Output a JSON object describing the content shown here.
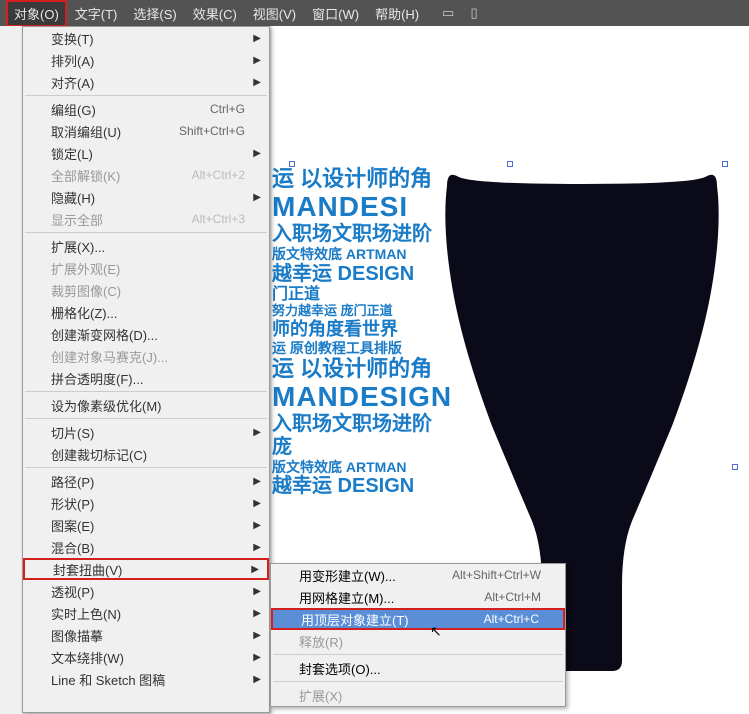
{
  "menubar": {
    "items": [
      "对象(O)",
      "文字(T)",
      "选择(S)",
      "效果(C)",
      "视图(V)",
      "窗口(W)",
      "帮助(H)"
    ]
  },
  "dropdown": {
    "items": [
      {
        "label": "变换(T)",
        "arrow": true
      },
      {
        "label": "排列(A)",
        "arrow": true
      },
      {
        "label": "对齐(A)",
        "arrow": true
      },
      {
        "sep": true
      },
      {
        "label": "编组(G)",
        "shortcut": "Ctrl+G"
      },
      {
        "label": "取消编组(U)",
        "shortcut": "Shift+Ctrl+G"
      },
      {
        "label": "锁定(L)",
        "arrow": true
      },
      {
        "label": "全部解锁(K)",
        "shortcut": "Alt+Ctrl+2",
        "disabled": true
      },
      {
        "label": "隐藏(H)",
        "arrow": true
      },
      {
        "label": "显示全部",
        "shortcut": "Alt+Ctrl+3",
        "disabled": true
      },
      {
        "sep": true
      },
      {
        "label": "扩展(X)..."
      },
      {
        "label": "扩展外观(E)",
        "disabled": true
      },
      {
        "label": "裁剪图像(C)",
        "disabled": true
      },
      {
        "label": "栅格化(Z)..."
      },
      {
        "label": "创建渐变网格(D)..."
      },
      {
        "label": "创建对象马赛克(J)...",
        "disabled": true
      },
      {
        "label": "拼合透明度(F)..."
      },
      {
        "sep": true
      },
      {
        "label": "设为像素级优化(M)"
      },
      {
        "sep": true
      },
      {
        "label": "切片(S)",
        "arrow": true
      },
      {
        "label": "创建裁切标记(C)"
      },
      {
        "sep": true
      },
      {
        "label": "路径(P)",
        "arrow": true
      },
      {
        "label": "形状(P)",
        "arrow": true
      },
      {
        "label": "图案(E)",
        "arrow": true
      },
      {
        "label": "混合(B)",
        "arrow": true
      },
      {
        "label": "封套扭曲(V)",
        "arrow": true,
        "highlighted": true
      },
      {
        "label": "透视(P)",
        "arrow": true
      },
      {
        "label": "实时上色(N)",
        "arrow": true
      },
      {
        "label": "图像描摹",
        "arrow": true
      },
      {
        "label": "文本绕排(W)",
        "arrow": true
      },
      {
        "label": "Line 和 Sketch 图稿",
        "arrow": true
      },
      {
        "sep_partial": true
      }
    ]
  },
  "submenu": {
    "items": [
      {
        "label": "用变形建立(W)...",
        "shortcut": "Alt+Shift+Ctrl+W"
      },
      {
        "label": "用网格建立(M)...",
        "shortcut": "Alt+Ctrl+M"
      },
      {
        "label": "用顶层对象建立(T)",
        "shortcut": "Alt+Ctrl+C",
        "highlighted": true
      },
      {
        "label": "释放(R)",
        "disabled": true
      },
      {
        "sep": true
      },
      {
        "label": "封套选项(O)..."
      },
      {
        "sep": true
      },
      {
        "label": "扩展(X)",
        "disabled": true
      }
    ]
  },
  "design_text": {
    "l1": "运 以设计师的角",
    "l2": "MANDESI",
    "l3": "入职场文职场进阶",
    "l4": "版文特效底 ARTMAN",
    "l5": "越幸运 DESIGN",
    "l6": "门正道",
    "l7": "努力越幸运 庞门正道",
    "l8": "师的角度看世界",
    "l9": "运 原创教程工具排版",
    "l2b": "MANDESIGN",
    "l3b": "入职场文职场进阶 庞"
  }
}
